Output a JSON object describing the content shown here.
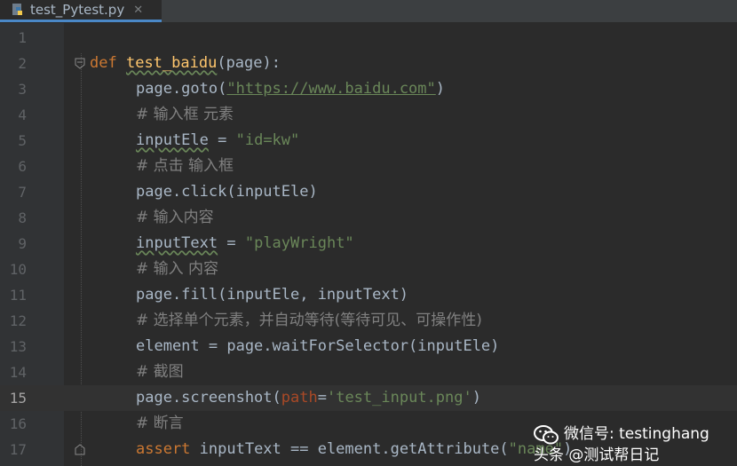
{
  "tab": {
    "filename": "test_Pytest.py",
    "close_glyph": "✕",
    "icon": "python-file-icon"
  },
  "lines": [
    {
      "n": "1"
    },
    {
      "n": "2",
      "parts": {
        "a": "def",
        "b": " ",
        "c": "test_baidu",
        "d": "(page):"
      }
    },
    {
      "n": "3",
      "parts": {
        "a": "page.goto(",
        "b": "\"https://www.baidu.com\"",
        "c": ")"
      }
    },
    {
      "n": "4",
      "text": "# 输入框 元素"
    },
    {
      "n": "5",
      "parts": {
        "a": "inputEle",
        "b": " = ",
        "c": "\"id=kw\""
      }
    },
    {
      "n": "6",
      "text": "# 点击 输入框"
    },
    {
      "n": "7",
      "text": "page.click(inputEle)"
    },
    {
      "n": "8",
      "text": "# 输入内容"
    },
    {
      "n": "9",
      "parts": {
        "a": "inputText",
        "b": " = ",
        "c": "\"playWright\""
      }
    },
    {
      "n": "10",
      "text": "# 输入 内容"
    },
    {
      "n": "11",
      "text": "page.fill(inputEle, inputText)"
    },
    {
      "n": "12",
      "text": "# 选择单个元素，并自动等待(等待可见、可操作性)"
    },
    {
      "n": "13",
      "text": "element = page.waitForSelector(inputEle)"
    },
    {
      "n": "14",
      "text": "# 截图"
    },
    {
      "n": "15",
      "parts": {
        "a": "page.screenshot(",
        "b": "path",
        "c": "=",
        "d": "'test_input.png'",
        "e": ")"
      }
    },
    {
      "n": "16",
      "text": "# 断言"
    },
    {
      "n": "17",
      "parts": {
        "a": "assert",
        "b": " inputText == element.getAttribute(",
        "c": "\"name\"",
        "d": ")"
      }
    }
  ],
  "watermark": {
    "line1": "微信号: testinghang",
    "line2": "头条 @测试帮日记",
    "logo_icon": "wechat-logo-icon"
  },
  "colors": {
    "background": "#2b2b2b",
    "keyword": "#cc7832",
    "function": "#ffc66d",
    "string": "#6a8759",
    "comment": "#808080",
    "text": "#a9b7c6",
    "param": "#aa4926"
  }
}
